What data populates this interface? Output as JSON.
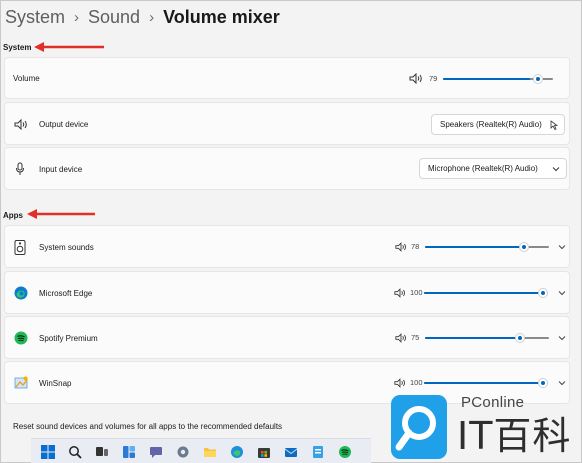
{
  "breadcrumb": {
    "items": [
      "System",
      "Sound"
    ],
    "current": "Volume mixer"
  },
  "system_section": {
    "label": "System"
  },
  "system": {
    "volume_label": "Volume",
    "volume_value": "79",
    "output_label": "Output device",
    "output_value": "Speakers (Realtek(R) Audio)",
    "input_label": "Input device",
    "input_value": "Microphone (Realtek(R) Audio)"
  },
  "apps_section": {
    "label": "Apps"
  },
  "apps": [
    {
      "name": "System sounds",
      "volume": "78",
      "level": 0.78,
      "icon": "system-sounds-icon"
    },
    {
      "name": "Microsoft Edge",
      "volume": "100",
      "level": 1.0,
      "icon": "edge-icon"
    },
    {
      "name": "Spotify Premium",
      "volume": "75",
      "level": 0.75,
      "icon": "spotify-icon"
    },
    {
      "name": "WinSnap",
      "volume": "100",
      "level": 1.0,
      "icon": "winsnap-icon"
    }
  ],
  "reset_text": "Reset sound devices and volumes for all apps to the recommended defaults",
  "taskbar_icons": [
    "windows-start-icon",
    "search-icon",
    "task-view-icon",
    "widgets-icon",
    "chat-icon",
    "settings-icon",
    "file-explorer-icon",
    "edge-icon",
    "store-icon",
    "mail-icon",
    "azure-data-icon",
    "spotify-icon"
  ],
  "watermark": {
    "brand": "PConline",
    "text": "IT百科"
  },
  "colors": {
    "accent": "#0067c0",
    "annotation_arrow": "#e0302a",
    "background": "#f3f3f3",
    "card": "#fbfbfb"
  }
}
